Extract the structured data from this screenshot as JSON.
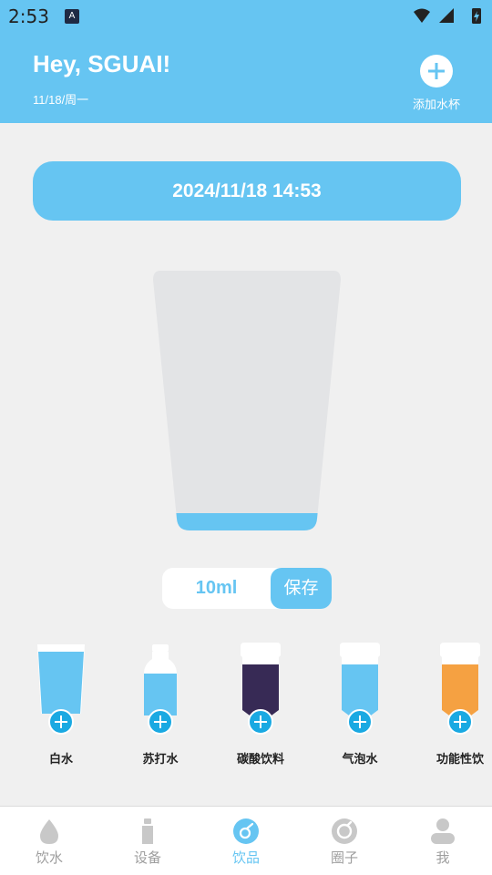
{
  "status_bar": {
    "time": "2:53",
    "badge": "A"
  },
  "header": {
    "greeting": "Hey, SGUAI!",
    "date_sub": "11/18/周一",
    "add_cup_label": "添加水杯"
  },
  "date_pill": "2024/11/18 14:53",
  "cup": {
    "fill_fraction": 0.07
  },
  "amount": {
    "value": "10ml",
    "save_label": "保存"
  },
  "drinks": [
    {
      "label": "白水",
      "icon": "cup-icon",
      "color": "#66c5f2"
    },
    {
      "label": "苏打水",
      "icon": "bottle-icon",
      "color": "#66c5f2"
    },
    {
      "label": "碳酸饮料",
      "icon": "can-icon",
      "color": "#372a55"
    },
    {
      "label": "气泡水",
      "icon": "can-icon",
      "color": "#66c5f2"
    },
    {
      "label": "功能性饮",
      "icon": "can-icon",
      "color": "#f5a142"
    }
  ],
  "nav": [
    {
      "label": "饮水",
      "icon": "water-drop-icon",
      "active": false
    },
    {
      "label": "设备",
      "icon": "bottle-icon",
      "active": false
    },
    {
      "label": "饮品",
      "icon": "drink-icon",
      "active": true
    },
    {
      "label": "圈子",
      "icon": "circle-icon",
      "active": false
    },
    {
      "label": "我",
      "icon": "user-icon",
      "active": false
    }
  ],
  "colors": {
    "accent": "#66c5f2",
    "plus": "#1aa9e2",
    "inactive": "#9e9e9e"
  }
}
